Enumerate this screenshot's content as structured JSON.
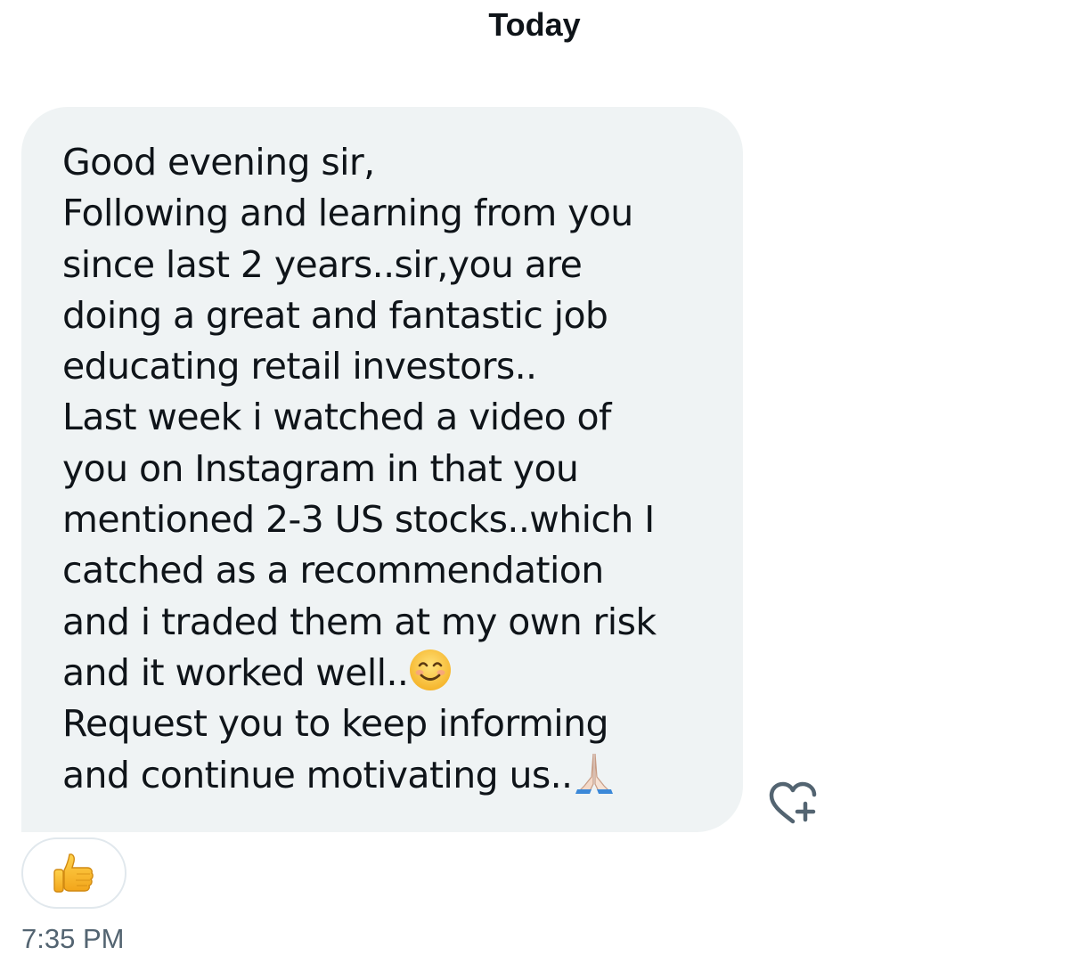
{
  "conversation": {
    "day_label": "Today"
  },
  "message": {
    "lines": [
      "Good evening sir,",
      "Following and learning from you",
      "since last 2 years..sir,you are",
      "doing a great and fantastic job",
      "educating retail investors..",
      "Last week i watched a video of",
      "you on Instagram in that you",
      "mentioned 2-3 US stocks..which I",
      "catched as a recommendation",
      "and i traded them at my own risk",
      "and it worked well..",
      "Request you to keep informing",
      "and continue motivating us.."
    ],
    "emoji_after_line_11": "smiling-face-with-smiling-eyes",
    "emoji_after_line_13": "folded-hands",
    "timestamp": "7:35 PM"
  },
  "reactions": [
    {
      "emoji": "thumbs-up",
      "icon": "thumbs-up-icon"
    }
  ],
  "actions": {
    "add_reaction_icon": "heart-plus-icon"
  },
  "colors": {
    "bubble_background": "#eff3f4",
    "text": "#0f1419",
    "muted_text": "#536471",
    "icon_stroke": "#536471",
    "pill_border": "#e1e8ed"
  }
}
